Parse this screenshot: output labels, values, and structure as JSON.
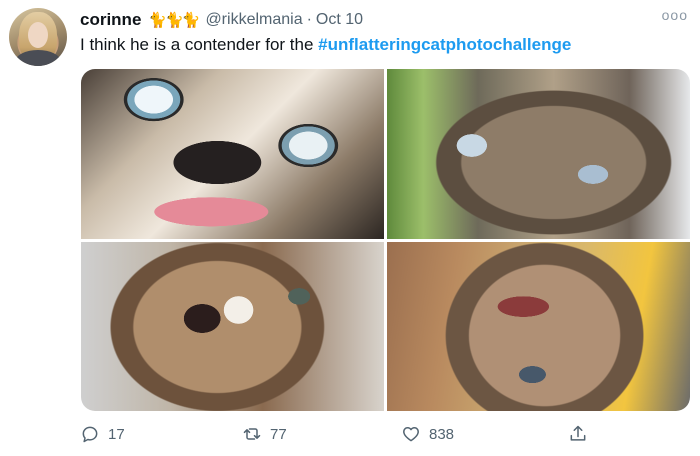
{
  "tweet": {
    "author": {
      "display_name": "corinne",
      "name_emoji": "🐈🐈🐈",
      "handle": "@rikkelmania",
      "separator": "·",
      "date": "Oct 10"
    },
    "more_label": "ooo",
    "text_prefix": "I think he is a contender for the ",
    "hashtag": "#unflatteringcatphotochallenge",
    "media_icons": [
      "cat-photo-1",
      "cat-photo-2",
      "cat-photo-3",
      "cat-photo-4"
    ],
    "actions": {
      "reply_count": "17",
      "retweet_count": "77",
      "like_count": "838"
    }
  },
  "colors": {
    "hashtag": "#1d9bf0",
    "secondary_text": "#536471",
    "primary_text": "#0f1419"
  }
}
